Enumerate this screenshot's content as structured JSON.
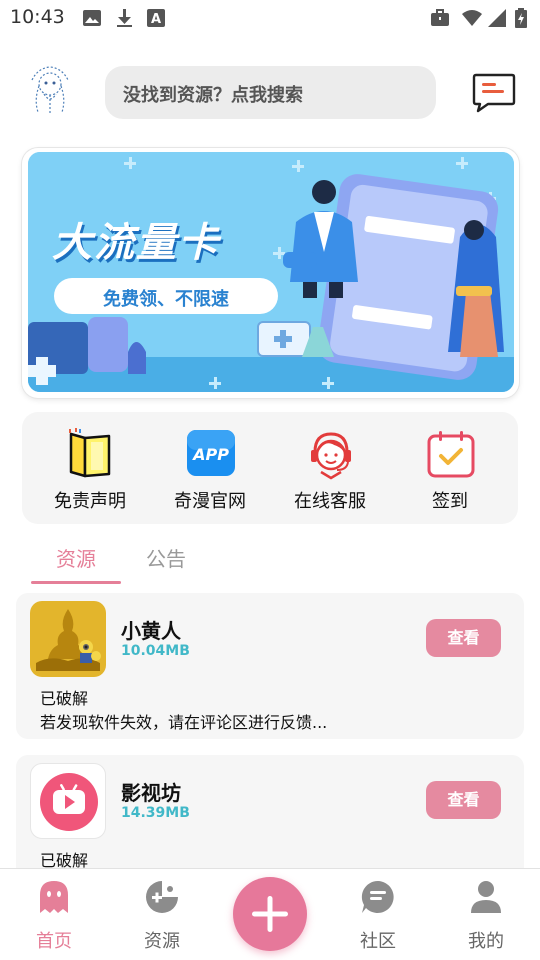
{
  "status_bar": {
    "time": "10:43",
    "icons": [
      "image-icon",
      "download-icon",
      "font-icon",
      "briefcase-icon",
      "wifi-icon",
      "signal-icon",
      "battery-icon"
    ]
  },
  "header": {
    "search_placeholder": "没找到资源？点我搜索",
    "message_icon": "message-icon"
  },
  "banner": {
    "title": "大流量卡",
    "subtitle": "免费领、不限速"
  },
  "quick_actions": [
    {
      "label": "免责声明",
      "icon": "book-icon"
    },
    {
      "label": "奇漫官网",
      "icon": "app-icon",
      "icon_text": "APP"
    },
    {
      "label": "在线客服",
      "icon": "headset-icon"
    },
    {
      "label": "签到",
      "icon": "calendar-check-icon"
    }
  ],
  "tabs": [
    {
      "label": "资源",
      "active": true
    },
    {
      "label": "公告",
      "active": false
    }
  ],
  "resources": [
    {
      "name": "小黄人",
      "size": "10.04MB",
      "button": "查看",
      "status": "已破解",
      "note": "若发现软件失效，请在评论区进行反馈..."
    },
    {
      "name": "影视坊",
      "size": "14.39MB",
      "button": "查看",
      "status": "已破解"
    }
  ],
  "bottom_nav": [
    {
      "label": "首页",
      "icon": "ghost-icon",
      "active": true
    },
    {
      "label": "资源",
      "icon": "gamepad-icon",
      "active": false
    },
    {
      "label": "",
      "icon": "plus-icon",
      "active": false
    },
    {
      "label": "社区",
      "icon": "chat-icon",
      "active": false
    },
    {
      "label": "我的",
      "icon": "user-icon",
      "active": false
    }
  ],
  "colors": {
    "accent": "#e57f98",
    "size_text": "#41b8c8",
    "banner_bg": "#7fd0f6"
  }
}
